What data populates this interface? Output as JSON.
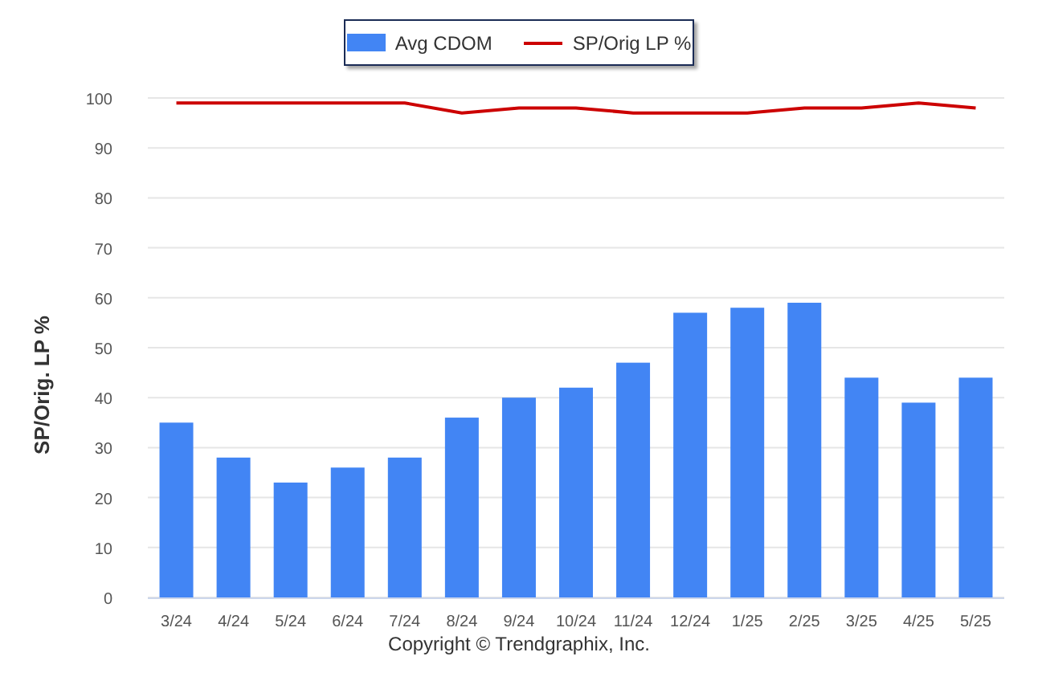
{
  "chart_data": {
    "type": "bar",
    "ylabel": "SP/Orig. LP %",
    "categories": [
      "3/24",
      "4/24",
      "5/24",
      "6/24",
      "7/24",
      "8/24",
      "9/24",
      "10/24",
      "11/24",
      "12/24",
      "1/25",
      "2/25",
      "3/25",
      "4/25",
      "5/25"
    ],
    "series": [
      {
        "name": "Avg CDOM",
        "color": "#4285f4",
        "values": [
          35,
          28,
          23,
          26,
          28,
          36,
          40,
          42,
          47,
          57,
          58,
          59,
          44,
          39,
          44
        ]
      },
      {
        "name": "SP/Orig LP %",
        "type": "line",
        "color": "#cc0000",
        "values": [
          99,
          99,
          99,
          99,
          99,
          97,
          98,
          98,
          97,
          97,
          97,
          98,
          98,
          99,
          98
        ]
      }
    ],
    "grid": true,
    "ylim": [
      0,
      100
    ],
    "yticks": [
      0,
      10,
      20,
      30,
      40,
      50,
      60,
      70,
      80,
      90,
      100
    ]
  },
  "footer": "Copyright © Trendgraphix, Inc."
}
